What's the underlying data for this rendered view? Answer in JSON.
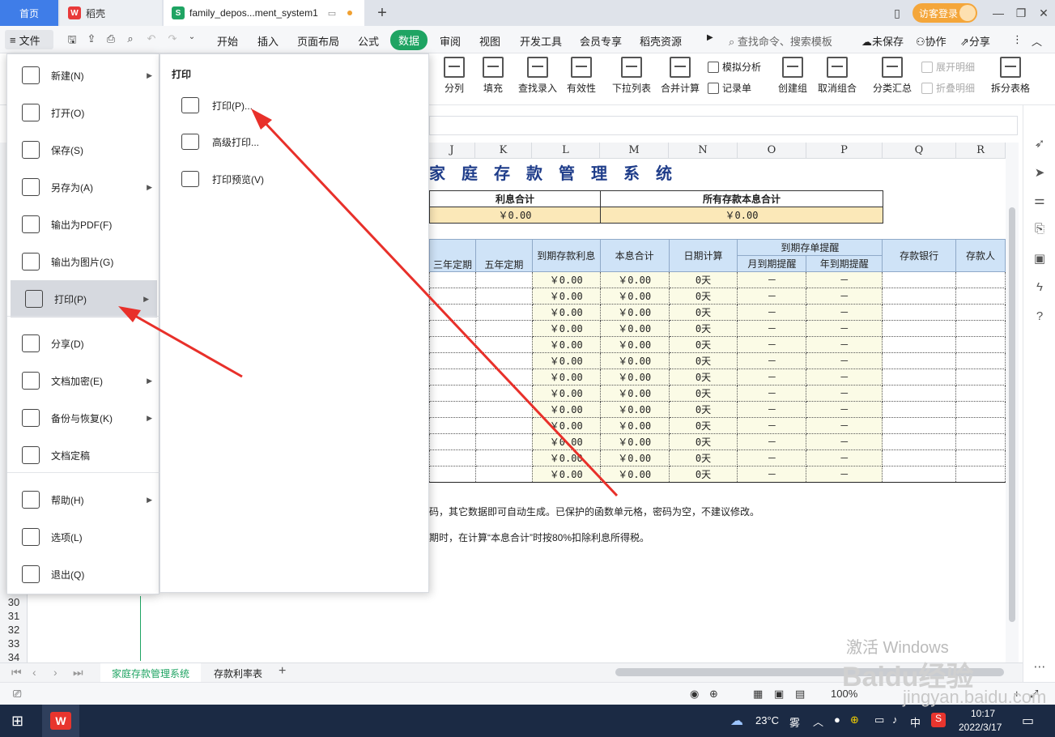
{
  "tabbar": {
    "home": "首页",
    "daoke": "稻壳",
    "doc": "family_depos...ment_system1",
    "new": "+",
    "visitor": "访客登录"
  },
  "menu": {
    "file": "文件",
    "tabs": [
      "开始",
      "插入",
      "页面布局",
      "公式",
      "数据",
      "审阅",
      "视图",
      "开发工具",
      "会员专享",
      "稻壳资源"
    ],
    "active_tab": "数据",
    "search": "查找命令、搜索模板",
    "unsaved": "未保存",
    "collab": "协作",
    "share": "分享"
  },
  "ribbon": {
    "split": "分列",
    "fill": "填充",
    "find_entry": "查找录入",
    "validity": "有效性",
    "dropdown_list": "下拉列表",
    "merge_calc": "合并计算",
    "simulate": "模拟分析",
    "record": "记录单",
    "create_group": "创建组",
    "ungroup": "取消组合",
    "subtotal": "分类汇总",
    "expand_detail": "展开明细",
    "collapse_detail": "折叠明细",
    "split_table": "拆分表格"
  },
  "sheet": {
    "columns": [
      "J",
      "K",
      "L",
      "M",
      "N",
      "O",
      "P",
      "Q",
      "R"
    ],
    "title": "家庭存款管理系统",
    "interest_total_label": "利息合计",
    "interest_total_value": "￥0.00",
    "all_total_label": "所有存款本息合计",
    "all_total_value": "￥0.00",
    "headers": {
      "three_year": "三年定期",
      "five_year": "五年定期",
      "due_interest": "到期存款利息",
      "principal_interest": "本息合计",
      "day_count": "日期计算",
      "reminder": "到期存单提醒",
      "monthly_reminder": "月到期提醒",
      "yearly_reminder": "年到期提醒",
      "bank": "存款银行",
      "depositor": "存款人"
    },
    "row_values": {
      "interest": "￥0.00",
      "total": "￥0.00",
      "days": "0天",
      "dash": "－"
    },
    "note1": "码，其它数据即可自动生成。已保护的函数单元格，密码为空，不建议修改。",
    "note2": "期时，在计算“本息合计”时按80%扣除利息所得税。",
    "row_numbers": [
      "30",
      "31",
      "32",
      "33",
      "34"
    ]
  },
  "sheet_tabs": [
    "家庭存款管理系统",
    "存款利率表"
  ],
  "status": {
    "zoom": "100%"
  },
  "file_menu": {
    "items": [
      {
        "label": "新建(N)",
        "arrow": true
      },
      {
        "label": "打开(O)",
        "arrow": false
      },
      {
        "label": "保存(S)",
        "arrow": false
      },
      {
        "label": "另存为(A)",
        "arrow": true
      },
      {
        "label": "输出为PDF(F)",
        "arrow": false
      },
      {
        "label": "输出为图片(G)",
        "arrow": false
      },
      {
        "label": "打印(P)",
        "arrow": true
      },
      {
        "label": "分享(D)",
        "arrow": false
      },
      {
        "label": "文档加密(E)",
        "arrow": true
      },
      {
        "label": "备份与恢复(K)",
        "arrow": true
      },
      {
        "label": "文档定稿",
        "arrow": false
      },
      {
        "label": "帮助(H)",
        "arrow": true
      },
      {
        "label": "选项(L)",
        "arrow": false
      },
      {
        "label": "退出(Q)",
        "arrow": false
      }
    ]
  },
  "print_submenu": {
    "title": "打印",
    "items": [
      "打印(P)...",
      "高级打印...",
      "打印预览(V)"
    ]
  },
  "taskbar": {
    "weather": "23°C",
    "weather_desc": "雾",
    "ime": "中",
    "time": "10:17",
    "date": "2022/3/17"
  },
  "watermark": {
    "line1": "激活 Windows",
    "brand": "Baidu经验",
    "url": "jingyan.baidu.com"
  },
  "colors": {
    "accent_green": "#1fa463",
    "tab_blue": "#3f7de8",
    "arrow_red": "#e8302a"
  }
}
